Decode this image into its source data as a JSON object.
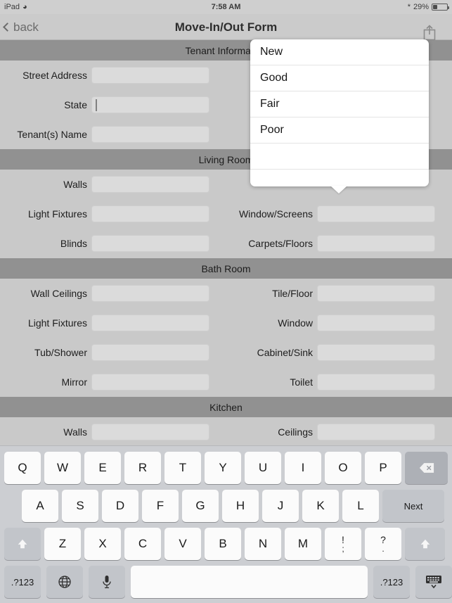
{
  "statusbar": {
    "device": "iPad",
    "wifi_icon": "wifi-icon",
    "time": "7:58 AM",
    "bluetooth_icon": "bluetooth-icon",
    "battery_percent": "29%"
  },
  "navbar": {
    "back_label": "back",
    "title": "Move-In/Out Form",
    "share_icon": "share-icon"
  },
  "popover": {
    "options": [
      "New",
      "Good",
      "Fair",
      "Poor",
      "",
      ""
    ]
  },
  "form": {
    "sections": [
      {
        "title": "Tenant Information",
        "rows": [
          {
            "left": {
              "label": "Street Address",
              "value": "",
              "focused": false
            },
            "right": {
              "label": "",
              "value": "",
              "focused": false
            }
          },
          {
            "left": {
              "label": "State",
              "value": "",
              "focused": true
            },
            "right": {
              "label": "",
              "value": "",
              "focused": false
            }
          },
          {
            "left": {
              "label": "Tenant(s) Name",
              "value": "",
              "focused": false
            },
            "right": {
              "label": "",
              "value": "",
              "focused": false
            }
          }
        ]
      },
      {
        "title": "Living Room",
        "rows": [
          {
            "left": {
              "label": "Walls",
              "value": "",
              "focused": false
            },
            "right": {
              "label": "",
              "value": "",
              "focused": false
            }
          },
          {
            "left": {
              "label": "Light Fixtures",
              "value": "",
              "focused": false
            },
            "right": {
              "label": "Window/Screens",
              "value": "",
              "focused": false
            }
          },
          {
            "left": {
              "label": "Blinds",
              "value": "",
              "focused": false
            },
            "right": {
              "label": "Carpets/Floors",
              "value": "",
              "focused": false
            }
          }
        ]
      },
      {
        "title": "Bath Room",
        "rows": [
          {
            "left": {
              "label": "Wall Ceilings",
              "value": "",
              "focused": false
            },
            "right": {
              "label": "Tile/Floor",
              "value": "",
              "focused": false
            }
          },
          {
            "left": {
              "label": "Light Fixtures",
              "value": "",
              "focused": false
            },
            "right": {
              "label": "Window",
              "value": "",
              "focused": false
            }
          },
          {
            "left": {
              "label": "Tub/Shower",
              "value": "",
              "focused": false
            },
            "right": {
              "label": "Cabinet/Sink",
              "value": "",
              "focused": false
            }
          },
          {
            "left": {
              "label": "Mirror",
              "value": "",
              "focused": false
            },
            "right": {
              "label": "Toilet",
              "value": "",
              "focused": false
            }
          }
        ]
      },
      {
        "title": "Kitchen",
        "rows": [
          {
            "left": {
              "label": "Walls",
              "value": "",
              "focused": false
            },
            "right": {
              "label": "Ceilings",
              "value": "",
              "focused": false
            }
          }
        ]
      }
    ]
  },
  "keyboard": {
    "row1": [
      "Q",
      "W",
      "E",
      "R",
      "T",
      "Y",
      "U",
      "I",
      "O",
      "P"
    ],
    "backspace_icon": "backspace-icon",
    "row2": [
      "A",
      "S",
      "D",
      "F",
      "G",
      "H",
      "J",
      "K",
      "L"
    ],
    "next_label": "Next",
    "row3": [
      "Z",
      "X",
      "C",
      "V",
      "B",
      "N",
      "M"
    ],
    "punct": [
      {
        "up": "!",
        "lo": ";"
      },
      {
        "up": "?",
        "lo": "."
      }
    ],
    "shift_icon": "shift-icon",
    "numeric_label": ".?123",
    "globe_icon": "globe-icon",
    "mic_icon": "microphone-icon",
    "space_label": "",
    "hide_keyboard_icon": "hide-keyboard-icon"
  },
  "colors": {
    "section_header": "#919191",
    "form_background": "#c9c9c9",
    "field_fill": "#dbdbdb",
    "keyboard_background": "#ccced2",
    "key_face": "#fbfbfb",
    "key_dark": "#adb0b6"
  }
}
